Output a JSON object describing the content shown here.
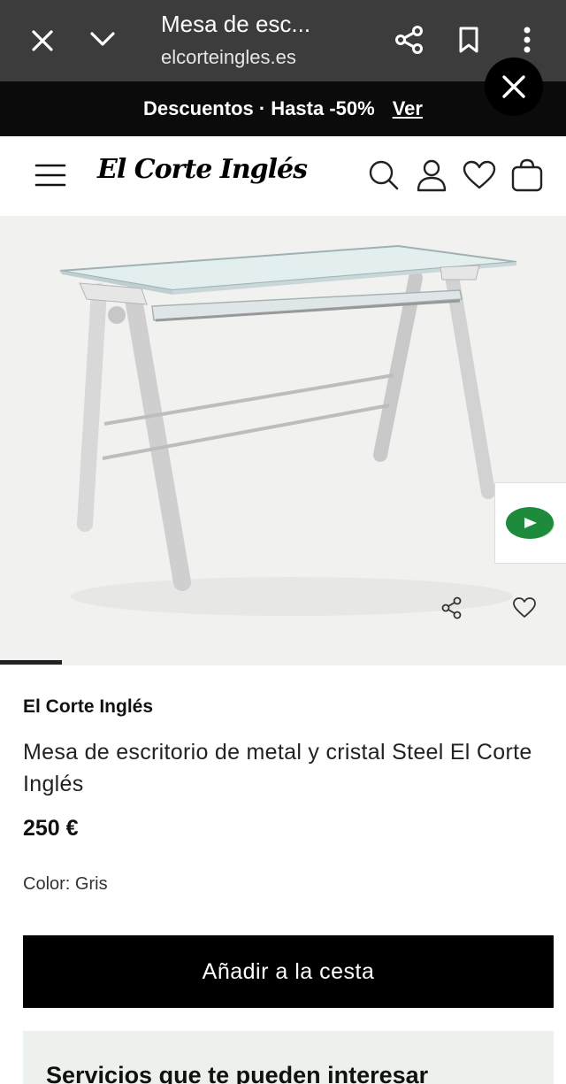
{
  "browser": {
    "title": "Mesa de esc...",
    "url": "elcorteingles.es",
    "icons": {
      "close": "close-icon",
      "collapse": "chevron-down-icon",
      "share": "share-icon",
      "bookmark": "bookmark-icon",
      "menu": "more-vert-icon"
    }
  },
  "promo": {
    "text": "Descuentos · Hasta -50%",
    "link_label": "Ver"
  },
  "header": {
    "logo_text": "El Corte Inglés",
    "icons": [
      "menu-icon",
      "search-icon",
      "user-icon",
      "heart-icon",
      "bag-icon"
    ]
  },
  "gallery": {
    "image_subject": "glass and chrome desk",
    "progress": 0.11
  },
  "product": {
    "brand": "El Corte Inglés",
    "name": "Mesa de escritorio de metal y cristal Steel El Corte Inglés",
    "price": "250 €",
    "color_label": "Color: Gris",
    "add_to_cart_label": "Añadir a la cesta"
  },
  "services": {
    "heading": "Servicios que te pueden interesar"
  },
  "colors": {
    "chrome_bg": "#3c3c3c",
    "promo_bg": "#0b0b0b",
    "button_bg": "#000000",
    "chat_green": "#1e8a3c",
    "services_bg": "#edf1ed"
  }
}
